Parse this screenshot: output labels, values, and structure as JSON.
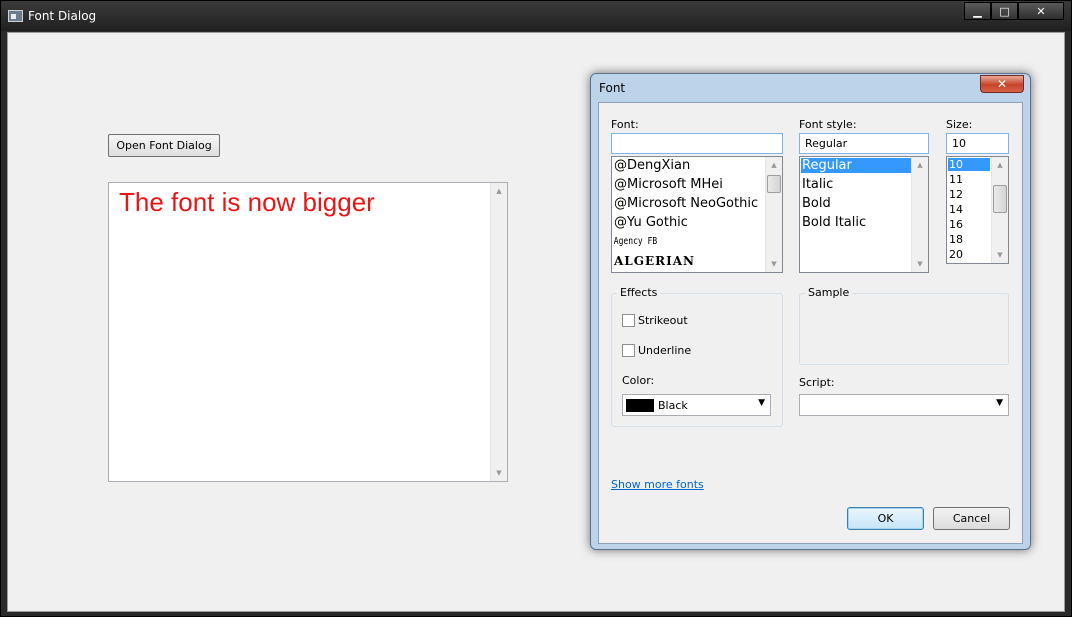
{
  "window": {
    "title": "Font Dialog",
    "minimize": "▁",
    "maximize": "□",
    "close": "✕"
  },
  "main": {
    "open_button_label": "Open Font Dialog",
    "text_content": "The font is now bigger",
    "text_color": "#e81616"
  },
  "dialog": {
    "title": "Font",
    "close": "✕",
    "font_label": "Font:",
    "font_value": "",
    "font_list": [
      "@DengXian",
      "@Microsoft MHei",
      "@Microsoft NeoGothic",
      "@Yu Gothic",
      "Agency FB",
      "ALGERIAN"
    ],
    "style_label": "Font style:",
    "style_value": "Regular",
    "style_list": [
      "Regular",
      "Italic",
      "Bold",
      "Bold Italic"
    ],
    "style_selected": "Regular",
    "size_label": "Size:",
    "size_value": "10",
    "size_list": [
      "10",
      "11",
      "12",
      "14",
      "16",
      "18",
      "20"
    ],
    "size_selected": "10",
    "effects_label": "Effects",
    "strikeout_label": "Strikeout",
    "underline_label": "Underline",
    "strikeout_checked": false,
    "underline_checked": false,
    "color_label": "Color:",
    "color_value": "Black",
    "color_swatch": "#000000",
    "sample_label": "Sample",
    "script_label": "Script:",
    "script_value": "",
    "show_more_link": "Show more fonts",
    "ok_label": "OK",
    "cancel_label": "Cancel"
  },
  "icons": {
    "app": "app-window-icon",
    "scroll_up": "▲",
    "scroll_down": "▼",
    "combo_down": "▼"
  }
}
